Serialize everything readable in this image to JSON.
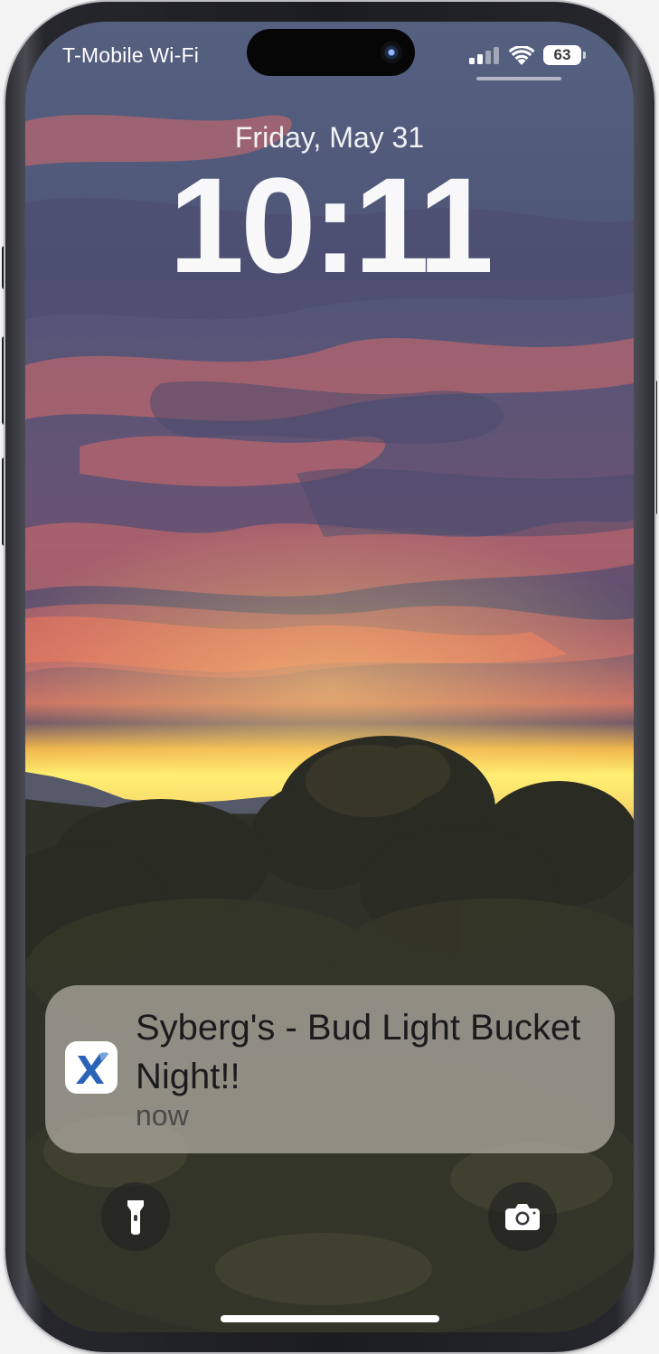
{
  "status_bar": {
    "carrier": "T-Mobile Wi-Fi",
    "battery_level": "63",
    "signal_icon": "cellular-signal-icon",
    "wifi_icon": "wifi-icon",
    "battery_icon": "battery-icon"
  },
  "lock_screen": {
    "date": "Friday, May 31",
    "time": "10:11"
  },
  "notification": {
    "title": "Syberg's - Bud Light Bucket Night!!",
    "time": "now",
    "app_icon": "x-logo-icon",
    "brand_color": "#2a63b8"
  },
  "quick_actions": {
    "left_icon": "flashlight-icon",
    "right_icon": "camera-icon"
  }
}
